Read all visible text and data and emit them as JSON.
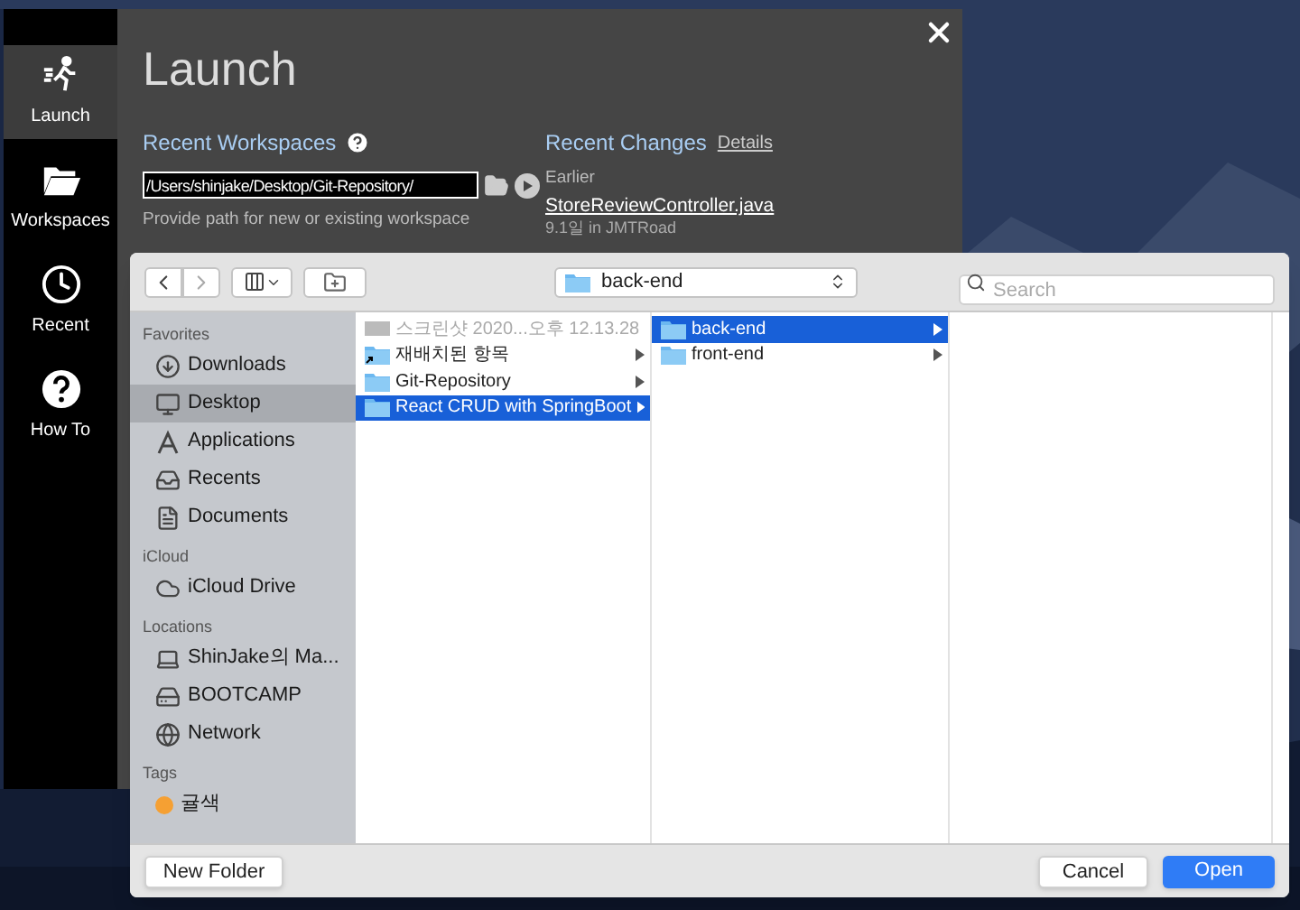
{
  "launcher": {
    "nav": [
      {
        "label": "Launch",
        "selected": true
      },
      {
        "label": "Workspaces",
        "selected": false
      },
      {
        "label": "Recent",
        "selected": false
      },
      {
        "label": "How To",
        "selected": false
      }
    ],
    "title": "Launch",
    "recent_workspaces": {
      "heading": "Recent Workspaces",
      "path": "/Users/shinjake/Desktop/Git-Repository/",
      "hint": "Provide path for new or existing workspace"
    },
    "recent_changes": {
      "heading": "Recent Changes",
      "details_link": "Details",
      "group": "Earlier",
      "file": "StoreReviewController.java",
      "meta": "9.1일 in JMTRoad"
    }
  },
  "dialog": {
    "location": "back-end",
    "search": {
      "placeholder": "Search"
    },
    "sidebar": [
      {
        "heading": "Favorites",
        "items": [
          {
            "label": "Downloads",
            "selected": false
          },
          {
            "label": "Desktop",
            "selected": true
          },
          {
            "label": "Applications",
            "selected": false
          },
          {
            "label": "Recents",
            "selected": false
          },
          {
            "label": "Documents",
            "selected": false
          }
        ]
      },
      {
        "heading": "iCloud",
        "items": [
          {
            "label": "iCloud Drive",
            "selected": false
          }
        ]
      },
      {
        "heading": "Locations",
        "items": [
          {
            "label": "ShinJake의 Ma...",
            "selected": false
          },
          {
            "label": "BOOTCAMP",
            "selected": false
          },
          {
            "label": "Network",
            "selected": false
          }
        ]
      },
      {
        "heading": "Tags",
        "items": [
          {
            "label": "귤색",
            "selected": false,
            "color": "#f5a033"
          }
        ]
      }
    ],
    "columns": [
      [
        {
          "name": "스크린샷 2020...오후 12.13.28",
          "kind": "file",
          "disabled": true,
          "selected": false
        },
        {
          "name": "재배치된 항목",
          "kind": "alias-folder",
          "disabled": false,
          "selected": false
        },
        {
          "name": "Git-Repository",
          "kind": "folder",
          "disabled": false,
          "selected": false
        },
        {
          "name": "React CRUD with SpringBoot",
          "kind": "folder",
          "disabled": false,
          "selected": true
        }
      ],
      [
        {
          "name": "back-end",
          "kind": "folder",
          "disabled": false,
          "selected": true
        },
        {
          "name": "front-end",
          "kind": "folder",
          "disabled": false,
          "selected": false
        }
      ]
    ],
    "buttons": [
      {
        "label": "New Folder",
        "kind": "plain"
      },
      {
        "label": "Cancel",
        "kind": "plain"
      },
      {
        "label": "Open",
        "kind": "primary"
      }
    ]
  }
}
